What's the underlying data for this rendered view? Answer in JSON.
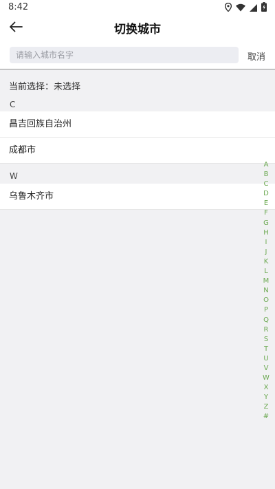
{
  "status_bar": {
    "time": "8:42",
    "icons": [
      "location-icon",
      "wifi-icon",
      "signal-icon",
      "battery-icon"
    ]
  },
  "header": {
    "title": "切换城市",
    "back_icon": "arrow-left-icon"
  },
  "search": {
    "placeholder": "请输入城市名字",
    "value": "",
    "cancel_label": "取消"
  },
  "current_selection": "当前选择：未选择",
  "sections": [
    {
      "letter": "C",
      "cities": [
        "昌吉回族自治州",
        "成都市"
      ]
    },
    {
      "letter": "W",
      "cities": [
        "乌鲁木齐市"
      ]
    }
  ],
  "index_letters": [
    "A",
    "B",
    "C",
    "D",
    "E",
    "F",
    "G",
    "H",
    "I",
    "J",
    "K",
    "L",
    "M",
    "N",
    "O",
    "P",
    "Q",
    "R",
    "S",
    "T",
    "U",
    "V",
    "W",
    "X",
    "Y",
    "Z",
    "#"
  ],
  "colors": {
    "index_letter": "#6aa84f",
    "background": "#f1f1f3",
    "search_bg": "#ecedf2"
  }
}
